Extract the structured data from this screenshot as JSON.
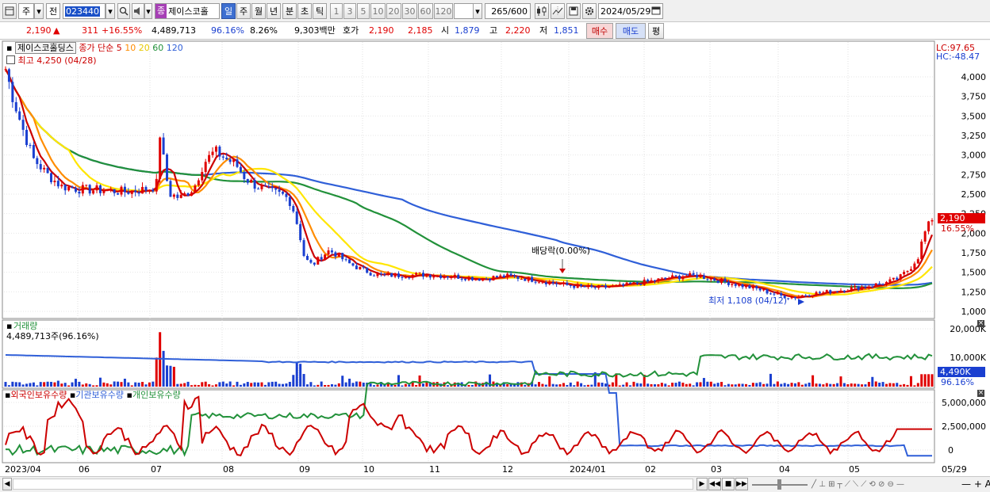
{
  "toolbar": {
    "type_label": "주",
    "prev_label": "전",
    "code": "023440",
    "stock_name": "제이스코홀",
    "jong_badge": "종",
    "periods": [
      "일",
      "주",
      "월",
      "년",
      "분",
      "초",
      "틱"
    ],
    "intervals": [
      "1",
      "3",
      "5",
      "10",
      "20",
      "30",
      "60",
      "120"
    ],
    "count_current": "265",
    "count_total": "/600",
    "date": "2024/05/29"
  },
  "quote": {
    "price": "2,190",
    "change": "311",
    "change_pct": "+16.55%",
    "volume": "4,489,713",
    "vol_ratio": "96.16%",
    "turnover": "8.26%",
    "amount": "9,303백만",
    "hoga_label": "호가",
    "ask": "2,190",
    "bid": "2,185",
    "open_label": "시",
    "open": "1,879",
    "high_label": "고",
    "high": "2,220",
    "low_label": "저",
    "low": "1,851",
    "buy_label": "매수",
    "sell_label": "매도",
    "avg_label": "평"
  },
  "price_panel": {
    "stock_title": "제이스코홀딩스",
    "ma_label": "종가 단순",
    "ma_periods": [
      "5",
      "10",
      "20",
      "60",
      "120"
    ],
    "high_note": "최고 4,250 (04/28)",
    "low_note": "최저 1,108 (04/12)",
    "dividend_note": "배당락(0.00%)",
    "lc": "LC:97.65",
    "hc": "HC:-48.47",
    "current_price_tag": "2,190",
    "current_pct_tag": "16.55%",
    "y_ticks": [
      "4,000",
      "3,750",
      "3,500",
      "3,250",
      "3,000",
      "2,750",
      "2,500",
      "2,250",
      "2,000",
      "1,750",
      "1,500",
      "1,250",
      "1,000"
    ]
  },
  "volume_panel": {
    "title": "거래량",
    "value": "4,489,713주(96.16%)",
    "y_ticks": [
      "20,000K",
      "10,000K"
    ],
    "current_tag": "4,490K",
    "current_pct": "96.16%"
  },
  "holding_panel": {
    "legend": [
      "외국인보유수량",
      "기관보유수량",
      "개인보유수량"
    ],
    "y_ticks": [
      "5,000,000",
      "2,500,000",
      "0"
    ]
  },
  "x_axis": [
    "2023/04",
    "06",
    "07",
    "08",
    "09",
    "10",
    "11",
    "12",
    "2024/01",
    "02",
    "03",
    "04",
    "05",
    "05/29"
  ],
  "colors": {
    "ma5": "#cc0000",
    "ma10": "#ff8c00",
    "ma20": "#ffe600",
    "ma60": "#22913a",
    "ma120": "#2f5fd8",
    "up": "#e00000",
    "down": "#1a3fd0"
  },
  "icons": [
    "menu-icon",
    "dropdown-icon",
    "search-icon",
    "speaker-icon",
    "candle-icon",
    "crosshair-icon",
    "save-icon",
    "gear-icon",
    "calendar-icon"
  ]
}
